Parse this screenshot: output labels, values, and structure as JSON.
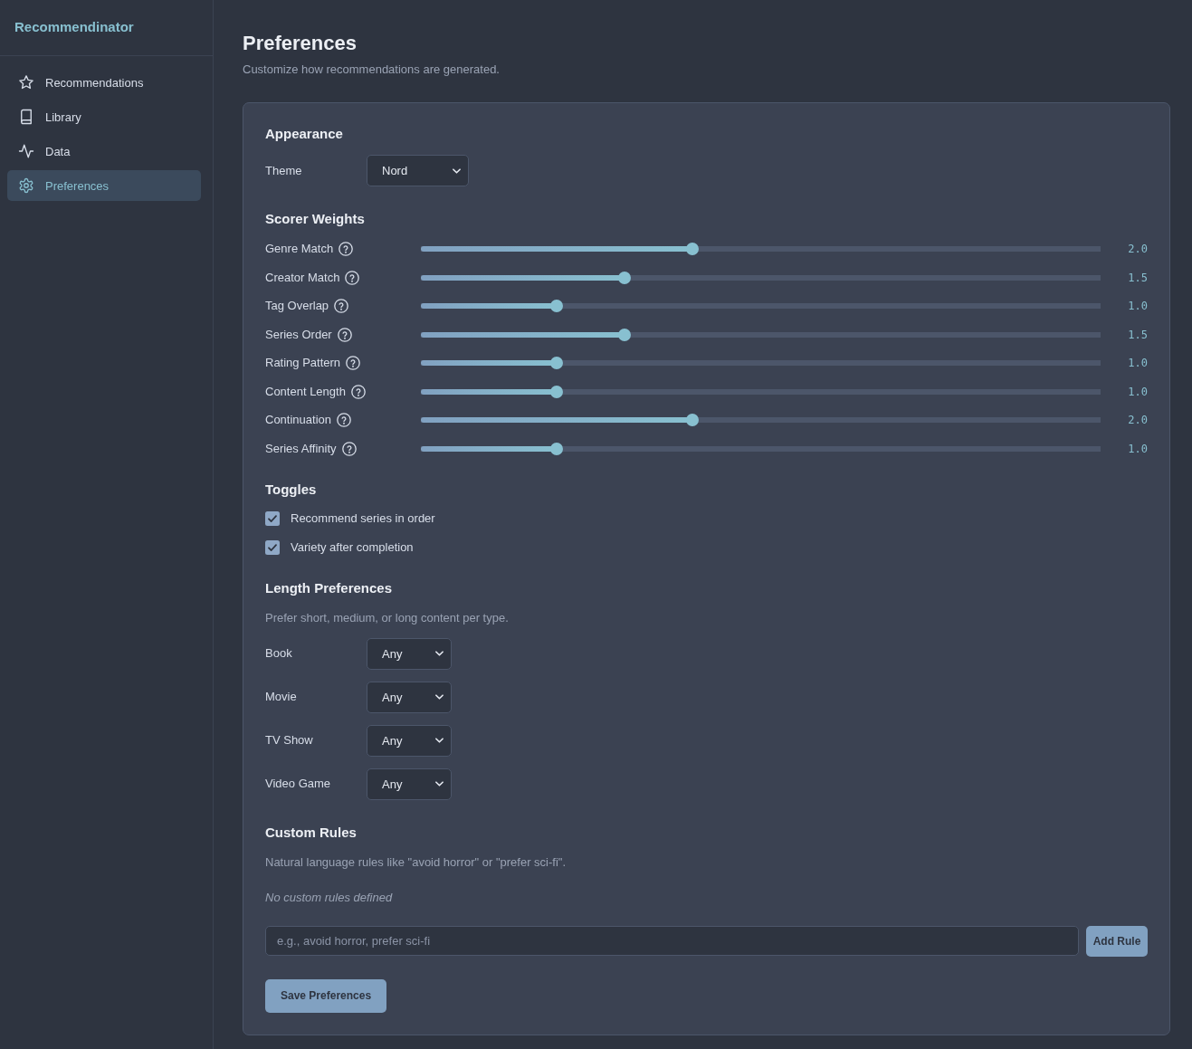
{
  "sidebar": {
    "brand": "Recommendinator",
    "items": [
      {
        "label": "Recommendations",
        "selected": false
      },
      {
        "label": "Library",
        "selected": false
      },
      {
        "label": "Data",
        "selected": false
      },
      {
        "label": "Preferences",
        "selected": true
      }
    ]
  },
  "page": {
    "title": "Preferences",
    "subtitle": "Customize how recommendations are generated."
  },
  "appearance": {
    "heading": "Appearance",
    "fields": [
      {
        "label": "Theme",
        "value": "Nord"
      }
    ]
  },
  "scorer_weights": {
    "heading": "Scorer Weights",
    "sliders": [
      {
        "label": "Genre Match",
        "level": 0.4,
        "reading": "2.0"
      },
      {
        "label": "Creator Match",
        "level": 0.3,
        "reading": "1.5"
      },
      {
        "label": "Tag Overlap",
        "level": 0.2,
        "reading": "1.0"
      },
      {
        "label": "Series Order",
        "level": 0.3,
        "reading": "1.5"
      },
      {
        "label": "Rating Pattern",
        "level": 0.2,
        "reading": "1.0"
      },
      {
        "label": "Content Length",
        "level": 0.2,
        "reading": "1.0"
      },
      {
        "label": "Continuation",
        "level": 0.4,
        "reading": "2.0"
      },
      {
        "label": "Series Affinity",
        "level": 0.2,
        "reading": "1.0"
      }
    ]
  },
  "toggles": {
    "heading": "Toggles",
    "items": [
      {
        "label": "Recommend series in order",
        "checked": true
      },
      {
        "label": "Variety after completion",
        "checked": true
      }
    ]
  },
  "length_preferences": {
    "heading": "Length Preferences",
    "description": "Prefer short, medium, or long content per type.",
    "fields": [
      {
        "label": "Book",
        "value": "Any"
      },
      {
        "label": "Movie",
        "value": "Any"
      },
      {
        "label": "TV Show",
        "value": "Any"
      },
      {
        "label": "Video Game",
        "value": "Any"
      }
    ]
  },
  "custom_rules": {
    "heading": "Custom Rules",
    "description": "Natural language rules like \"avoid horror\" or \"prefer sci-fi\".",
    "empty_message": "No custom rules defined",
    "input": {
      "placeholder": "e.g., avoid horror, prefer sci-fi"
    },
    "add_button": "Add Rule"
  },
  "save_button": "Save Preferences"
}
